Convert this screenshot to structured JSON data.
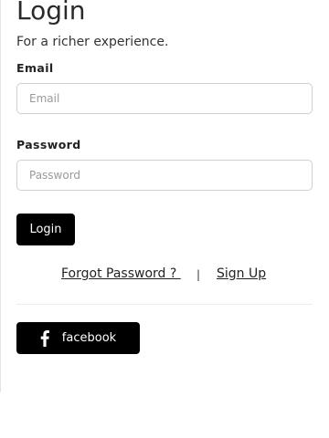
{
  "header": {
    "title": "Login",
    "subtitle": "For a richer experience."
  },
  "form": {
    "email_label": "Email",
    "email_value": "",
    "email_placeholder": "Email",
    "password_label": "Password",
    "password_value": "",
    "password_placeholder": "Password",
    "login_button_label": "Login"
  },
  "links": {
    "forgot_password": "Forgot Password ? ",
    "separator": "|",
    "sign_up": "Sign Up"
  },
  "social": {
    "facebook_label": "facebook",
    "facebook_icon": "facebook-f-icon"
  },
  "colors": {
    "button_background": "#000000",
    "button_text": "#ffffff",
    "input_border": "#cfcfcf",
    "text": "#222222"
  }
}
